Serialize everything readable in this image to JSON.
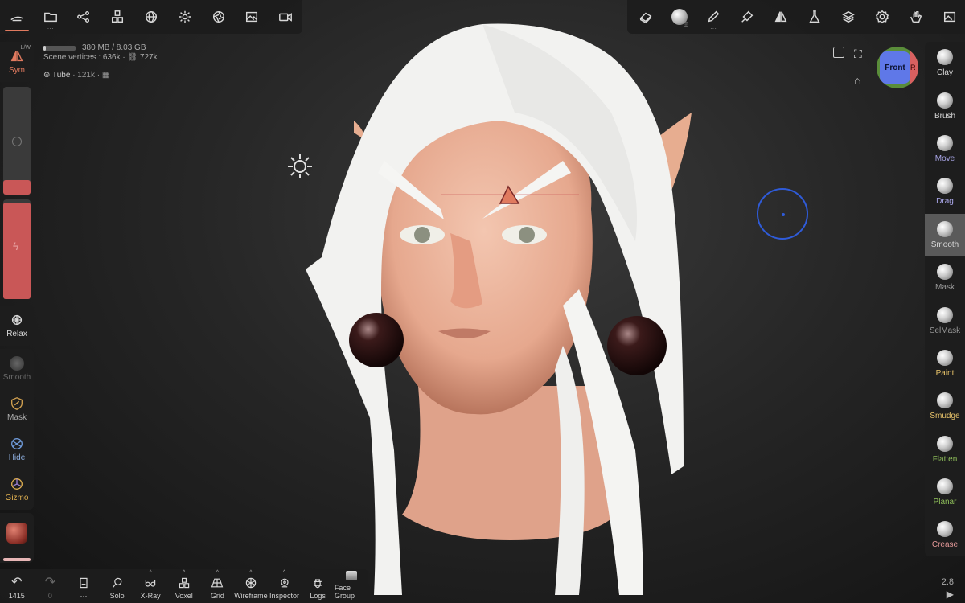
{
  "top_left_toolbar": {
    "items": [
      {
        "name": "sculpt-icon"
      },
      {
        "name": "files-icon"
      },
      {
        "name": "scene-graph-icon"
      },
      {
        "name": "topology-icon"
      },
      {
        "name": "material-sphere-icon"
      },
      {
        "name": "light-icon"
      },
      {
        "name": "aperture-icon"
      },
      {
        "name": "image-icon"
      },
      {
        "name": "video-icon"
      }
    ]
  },
  "top_right_toolbar": {
    "items": [
      {
        "name": "eraser-icon"
      },
      {
        "name": "stroke-sphere-icon"
      },
      {
        "name": "pencil-icon"
      },
      {
        "name": "paint-icon"
      },
      {
        "name": "symmetry-icon"
      },
      {
        "name": "flask-icon"
      },
      {
        "name": "layers-icon"
      },
      {
        "name": "settings-icon"
      },
      {
        "name": "gesture-icon"
      }
    ]
  },
  "stats": {
    "memory": "380 MB / 8.03 GB",
    "vertices_label": "Scene vertices : 636k · ",
    "faces": "727k",
    "mesh_name": "Tube",
    "mesh_count": "· 121k ·"
  },
  "left_tools": {
    "sym_label": "Sym",
    "sym_badge": "L/W",
    "relax": "Relax",
    "smooth": "Smooth",
    "mask": "Mask",
    "hide": "Hide",
    "gizmo": "Gizmo"
  },
  "right_tools": [
    {
      "label": "Clay",
      "color": "#d8d8d8"
    },
    {
      "label": "Brush",
      "color": "#d8d8d8"
    },
    {
      "label": "Move",
      "color": "#a9a6e8"
    },
    {
      "label": "Drag",
      "color": "#a9a6e8"
    },
    {
      "label": "Smooth",
      "color": "#d8d8d8"
    },
    {
      "label": "Mask",
      "color": "#9a9a9a"
    },
    {
      "label": "SelMask",
      "color": "#9a9a9a"
    },
    {
      "label": "Paint",
      "color": "#e9c46a"
    },
    {
      "label": "Smudge",
      "color": "#e9c46a"
    },
    {
      "label": "Flatten",
      "color": "#8fbf5a"
    },
    {
      "label": "Planar",
      "color": "#8fbf5a"
    },
    {
      "label": "Crease",
      "color": "#e79a9a"
    }
  ],
  "bottom_bar": {
    "undo_count": "1415",
    "redo_count": "0",
    "more": "···",
    "items": [
      "Solo",
      "X-Ray",
      "Voxel",
      "Grid",
      "Wireframe",
      "Inspector",
      "Logs",
      "Face Group"
    ]
  },
  "view_cube": {
    "front": "Front",
    "right": "R"
  },
  "version": "2.8",
  "colors": {
    "accent": "#e07a5f",
    "panel": "#1c1c1c",
    "cursor_ring": "#2f5bd8"
  }
}
